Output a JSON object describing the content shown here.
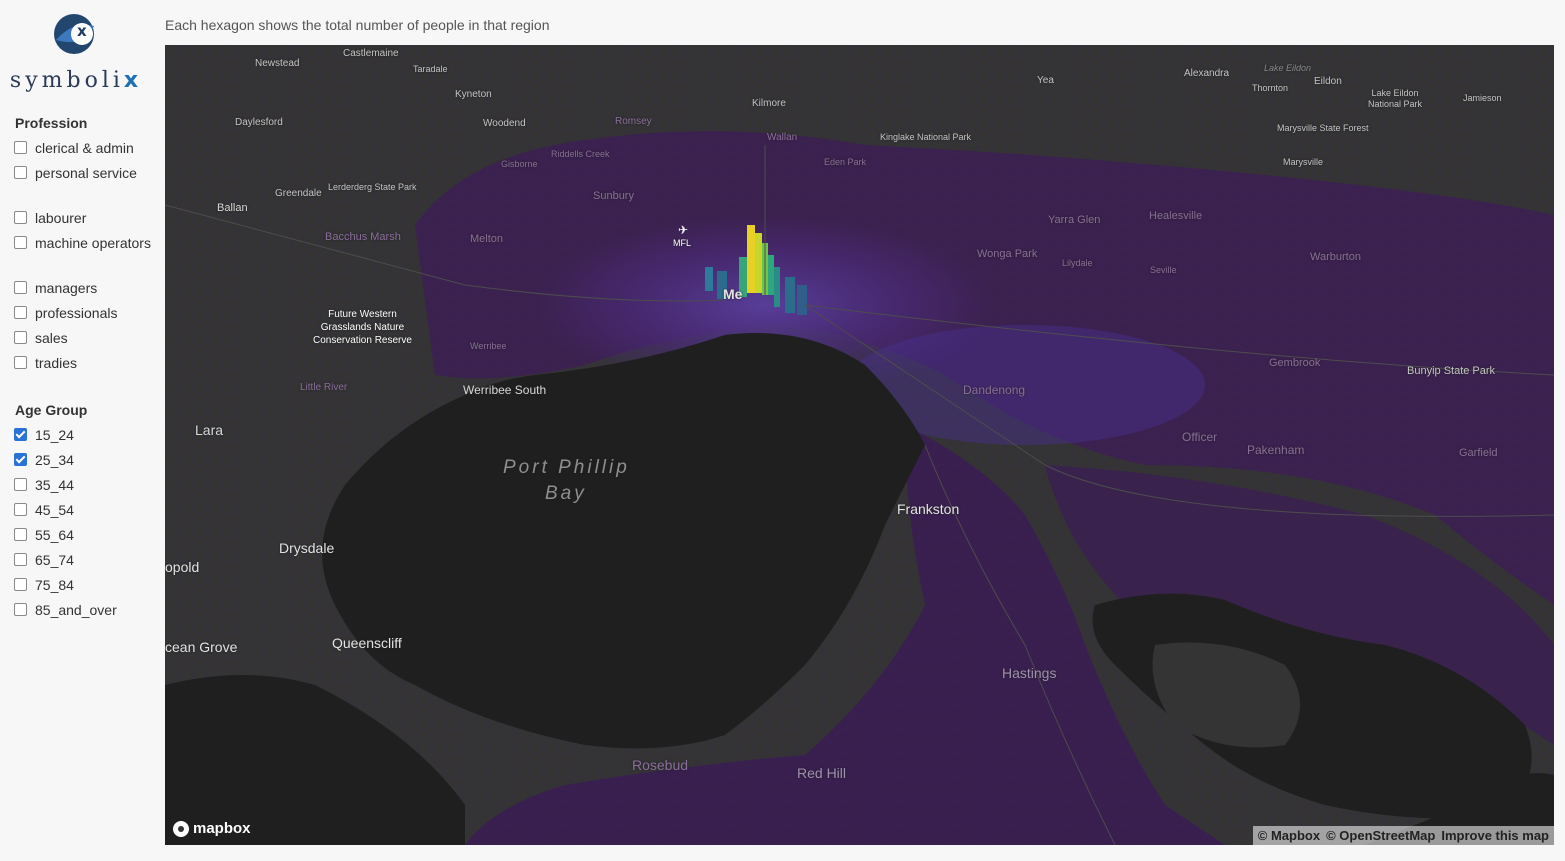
{
  "logo": {
    "text_main": "symboli",
    "text_accent": "x",
    "badge_letter": "x"
  },
  "caption": "Each hexagon shows the total number of people in that region",
  "profession": {
    "title": "Profession",
    "options": [
      {
        "label": "clerical & admin",
        "checked": false
      },
      {
        "label": "personal service",
        "checked": false
      },
      {
        "label": "labourer",
        "checked": false
      },
      {
        "label": "machine operators",
        "checked": false
      },
      {
        "label": "managers",
        "checked": false
      },
      {
        "label": "professionals",
        "checked": false
      },
      {
        "label": "sales",
        "checked": false
      },
      {
        "label": "tradies",
        "checked": false
      }
    ]
  },
  "age_group": {
    "title": "Age Group",
    "options": [
      {
        "label": "15_24",
        "checked": true
      },
      {
        "label": "25_34",
        "checked": true
      },
      {
        "label": "35_44",
        "checked": false
      },
      {
        "label": "45_54",
        "checked": false
      },
      {
        "label": "55_64",
        "checked": false
      },
      {
        "label": "65_74",
        "checked": false
      },
      {
        "label": "75_84",
        "checked": false
      },
      {
        "label": "85_and_over",
        "checked": false
      }
    ]
  },
  "map": {
    "places": {
      "newstead": "Newstead",
      "castlemaine": "Castlemaine",
      "taradale": "Taradale",
      "kyneton": "Kyneton",
      "daylesford": "Daylesford",
      "woodend": "Woodend",
      "romsey": "Romsey",
      "riddells_creek": "Riddells Creek",
      "gisborne": "Gisborne",
      "kilmore": "Kilmore",
      "wallan": "Wallan",
      "kinglake": "Kinglake National Park",
      "eden_park": "Eden Park",
      "yea": "Yea",
      "alexandra": "Alexandra",
      "lake_eildon": "Lake Eildon",
      "thornton": "Thornton",
      "eildon": "Eildon",
      "lake_eildon_np": "Lake Eildon National Park",
      "jamieson": "Jamieson",
      "marysville_sf": "Marysville State Forest",
      "marysville": "Marysville",
      "greendale": "Greendale",
      "lerderderg": "Lerderderg State Park",
      "ballan": "Ballan",
      "sunbury": "Sunbury",
      "bacchus_marsh": "Bacchus Marsh",
      "melton": "Melton",
      "mfl": "MFL",
      "melbourne": "Me",
      "yarra_glen": "Yarra Glen",
      "healesville": "Healesville",
      "wonga_park": "Wonga Park",
      "lilydale": "Lilydale",
      "seville": "Seville",
      "warburton": "Warburton",
      "future_western": "Future Western\nGrasslands Nature\nConservation Reserve",
      "werribee": "Werribee",
      "werribee_south": "Werribee South",
      "little_river": "Little River",
      "gembrook": "Gembrook",
      "bunyip": "Bunyip State Park",
      "dandenong": "Dandenong",
      "officer": "Officer",
      "pakenham": "Pakenham",
      "garfield": "Garfield",
      "lara": "Lara",
      "port_phillip": "Port Phillip",
      "bay": "Bay",
      "frankston": "Frankston",
      "drysdale": "Drysdale",
      "leopold": "opold",
      "ocean_grove": "cean Grove",
      "queenscliff": "Queenscliff",
      "hastings": "Hastings",
      "rosebud": "Rosebud",
      "red_hill": "Red Hill"
    },
    "mapbox_label": "mapbox",
    "attribution": [
      "© Mapbox",
      "© OpenStreetMap",
      "Improve this map"
    ]
  }
}
